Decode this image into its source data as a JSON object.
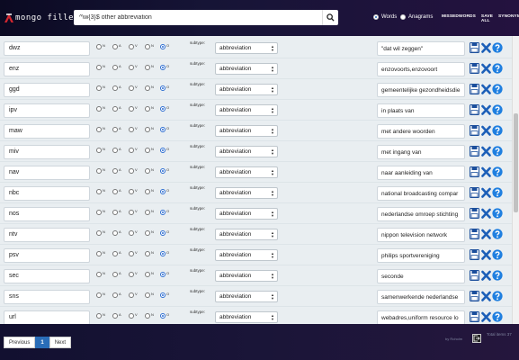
{
  "header": {
    "logo_text": "mongo filler",
    "search_value": "^\\w{3}$ other abbreviation",
    "modes": [
      {
        "label": "Words",
        "selected": true
      },
      {
        "label": "Anagrams",
        "selected": false
      }
    ],
    "nav": [
      "MISSEDWORDS",
      "SAVE ALL",
      "SYNONYMS"
    ]
  },
  "row_labels": {
    "radios": [
      "N",
      "A",
      "V",
      "N",
      "O"
    ],
    "subtype": "subtype:"
  },
  "rows": [
    {
      "word": "dwz",
      "type": "abbreviation",
      "definition": "\"dat wil zeggen\""
    },
    {
      "word": "enz",
      "type": "abbreviation",
      "definition": "enzovoorts,enzovoort"
    },
    {
      "word": "ggd",
      "type": "abbreviation",
      "definition": "gemeentelijke gezondheidsdie"
    },
    {
      "word": "ipv",
      "type": "abbreviation",
      "definition": "in plaats van"
    },
    {
      "word": "maw",
      "type": "abbreviation",
      "definition": "met andere woorden"
    },
    {
      "word": "miv",
      "type": "abbreviation",
      "definition": "met ingang van"
    },
    {
      "word": "nav",
      "type": "abbreviation",
      "definition": "naar aanleiding van"
    },
    {
      "word": "nbc",
      "type": "abbreviation",
      "definition": "national broadcasting compar"
    },
    {
      "word": "nos",
      "type": "abbreviation",
      "definition": "nederlandse omroep stichting"
    },
    {
      "word": "ntv",
      "type": "abbreviation",
      "definition": "nippon television network"
    },
    {
      "word": "psv",
      "type": "abbreviation",
      "definition": "philips sportvereniging"
    },
    {
      "word": "sec",
      "type": "abbreviation",
      "definition": "seconde"
    },
    {
      "word": "sns",
      "type": "abbreviation",
      "definition": "samenwerkende nederlandse"
    },
    {
      "word": "url",
      "type": "abbreviation",
      "definition": "webadres,uniform resource lo"
    }
  ],
  "footer": {
    "previous": "Previous",
    "page": "1",
    "next": "Next",
    "credit": "by Roholm",
    "total": "Total items 37"
  },
  "colors": {
    "accent": "#2a6db8",
    "delete": "#1c5fb8",
    "help": "#1f7fe0",
    "logo_red": "#d3262f"
  }
}
